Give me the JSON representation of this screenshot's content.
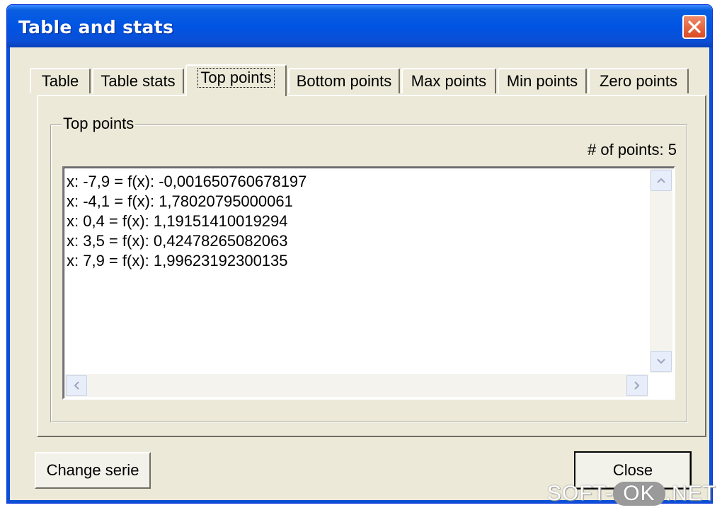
{
  "window": {
    "title": "Table and stats"
  },
  "tabs": [
    {
      "label": "Table"
    },
    {
      "label": "Table stats"
    },
    {
      "label": "Top points",
      "active": true
    },
    {
      "label": "Bottom points"
    },
    {
      "label": "Max points"
    },
    {
      "label": "Min points"
    },
    {
      "label": "Zero points"
    }
  ],
  "group": {
    "label": "Top points",
    "count_text": "# of points: 5"
  },
  "list": {
    "lines": [
      "x: -7,9 = f(x): -0,001650760678197",
      "x: -4,1 = f(x): 1,78020795000061",
      "x: 0,4 = f(x): 1,19151410019294",
      "x: 3,5 = f(x): 0,42478265082063",
      "x: 7,9 = f(x): 1,99623192300135"
    ]
  },
  "buttons": {
    "change_serie": "Change serie",
    "close": "Close"
  },
  "watermark": {
    "left": "SOFT-",
    "pill": "OK",
    "right": ".NET"
  },
  "colors": {
    "titlebar": "#0054e3",
    "face": "#ece9d8",
    "close_button": "#d94a22"
  },
  "icons": [
    "close-icon",
    "scroll-up-icon",
    "scroll-down-icon",
    "scroll-left-icon",
    "scroll-right-icon"
  ]
}
